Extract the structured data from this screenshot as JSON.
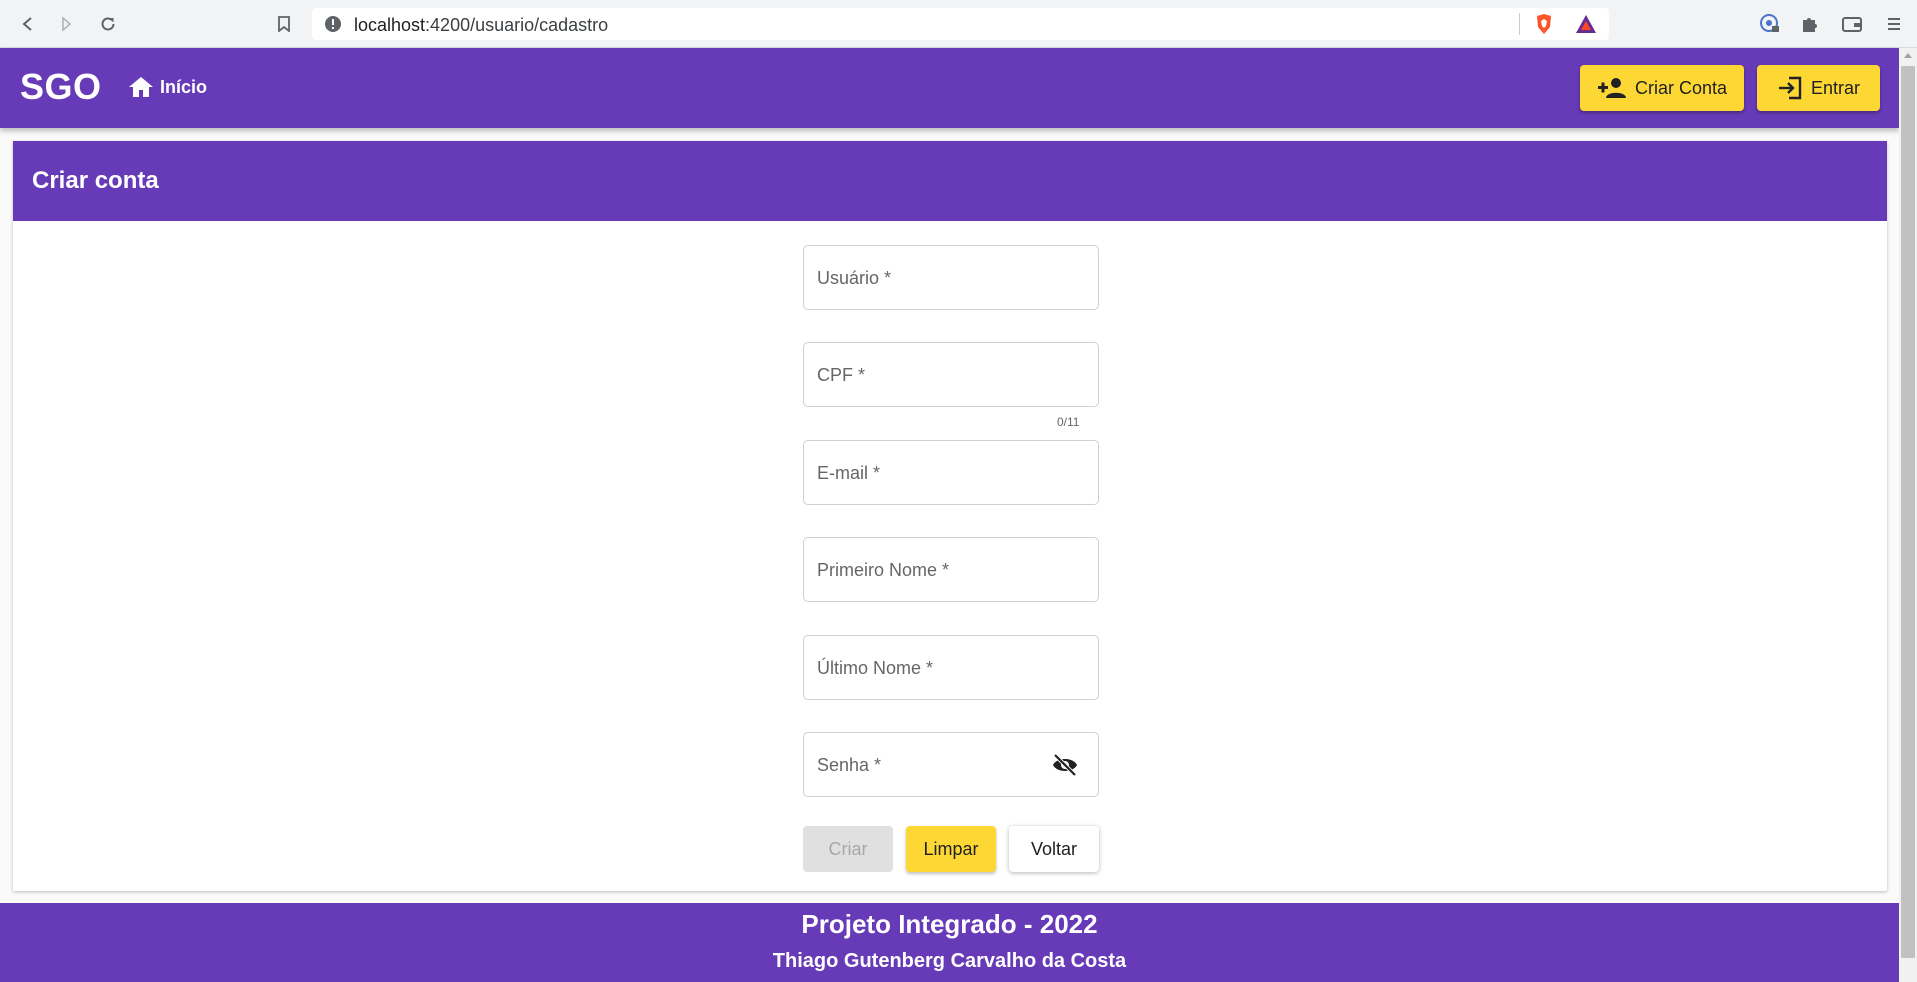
{
  "browser": {
    "url_host": "localhost",
    "url_path": ":4200/usuario/cadastro"
  },
  "toolbar": {
    "brand": "SGO",
    "home_label": "Início",
    "signup_label": "Criar Conta",
    "login_label": "Entrar"
  },
  "card": {
    "title": "Criar conta"
  },
  "form": {
    "usuario_label": "Usuário *",
    "cpf_label": "CPF *",
    "cpf_hint": "0/11",
    "email_label": "E-mail *",
    "first_name_label": "Primeiro Nome *",
    "last_name_label": "Último Nome *",
    "password_label": "Senha *"
  },
  "actions": {
    "create_label": "Criar",
    "clear_label": "Limpar",
    "back_label": "Voltar"
  },
  "footer": {
    "title": "Projeto Integrado - 2022",
    "author": "Thiago Gutenberg Carvalho da Costa"
  },
  "colors": {
    "primary": "#673ab7",
    "accent": "#fdd835"
  },
  "icons": {
    "home": "home-icon",
    "signup": "person-add-icon",
    "login": "login-icon",
    "password_toggle": "visibility-off-icon"
  }
}
